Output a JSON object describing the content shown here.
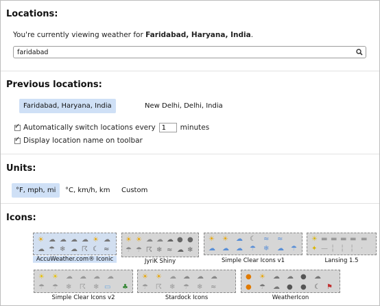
{
  "locations": {
    "title": "Locations:",
    "viewing_prefix": "You're currently viewing weather for ",
    "viewing_location": "Faridabad, Haryana, India",
    "viewing_suffix": ".",
    "search_value": "faridabad"
  },
  "previous": {
    "title": "Previous locations:",
    "items": [
      "Faridabad, Haryana, India",
      "New Delhi, Delhi, India"
    ],
    "auto_switch_label_before": "Automatically switch locations every",
    "auto_switch_value": "1",
    "auto_switch_label_after": "minutes",
    "display_name_label": "Display location name on toolbar"
  },
  "units": {
    "title": "Units:",
    "options": [
      "°F, mph, mi",
      "°C, km/h, km",
      "Custom"
    ]
  },
  "icons": {
    "title": "Icons:",
    "sets": [
      "AccuWeather.com® Iconic",
      "JyriK Shiny",
      "Simple Clear Icons v1",
      "Lansing 1.5",
      "Simple Clear Icons v2",
      "Stardock Icons",
      "WeatherIcon"
    ],
    "icon_names": [
      "sun-icon",
      "cloud-icon",
      "rain-icon",
      "snow-icon",
      "storm-icon",
      "moon-icon",
      "wind-icon"
    ]
  },
  "colors": {
    "selected": "#cfe0f6",
    "separator": "#e2e2e2",
    "preview_bg": "#d6d6d6"
  }
}
